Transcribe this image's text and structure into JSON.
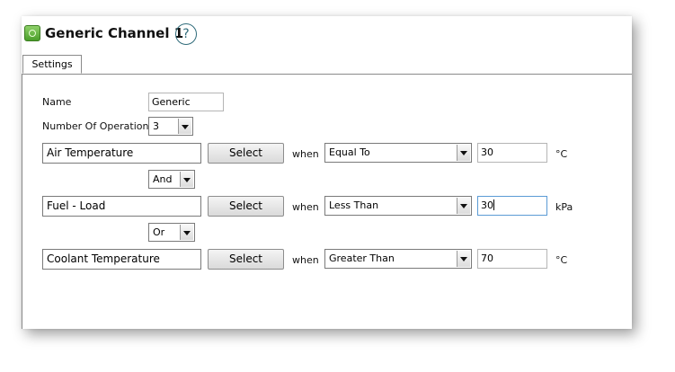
{
  "header": {
    "title": "Generic Channel 1",
    "help_label": "?",
    "app_icon": "channel-icon",
    "help_icon": "question-mark-icon",
    "accent_color": "#2f6b7a"
  },
  "tabs": [
    {
      "label": "Settings",
      "active": true
    }
  ],
  "form": {
    "name_label": "Name",
    "name_value": "Generic",
    "ops_label": "Number Of Operations",
    "ops_value": "3",
    "operations": [
      {
        "channel": "Air Temperature",
        "select_label": "Select",
        "when_label": "when",
        "comparison": "Equal To",
        "value": "30",
        "unit": "°C"
      },
      {
        "channel": "Fuel - Load",
        "select_label": "Select",
        "when_label": "when",
        "comparison": "Less Than",
        "value": "30",
        "unit": "kPa"
      },
      {
        "channel": "Coolant Temperature",
        "select_label": "Select",
        "when_label": "when",
        "comparison": "Greater Than",
        "value": "70",
        "unit": "°C"
      }
    ],
    "logic": [
      "And",
      "Or"
    ]
  }
}
